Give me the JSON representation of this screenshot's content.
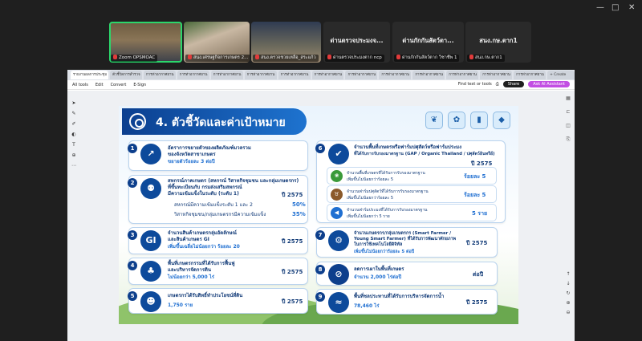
{
  "window": {
    "minimize": "—",
    "maximize": "□",
    "close": "✕"
  },
  "meeting": {
    "tiles": [
      {
        "name": "Zoom OPSMOAC",
        "label": "Zoom OPSMOAC"
      },
      {
        "name": "สนง.เศรษฐกิจการเกษตร",
        "label": "สนง.เศรษฐกิจการเกษตร 2..."
      },
      {
        "name": "สนง.ตรวจชวยเหลือ",
        "label": "สนง.ตรวจชวยเหลือ_สระแก้ว"
      },
      {
        "name": "ด่านตรวจประมงจ...",
        "label": "ด่านตรวจประมงตาก ncp"
      },
      {
        "name": "ด่านกักกันสัตว์ตา...",
        "label": "ด่านกักกันสัตว์ตาก วิชาชีพ 1"
      },
      {
        "name": "สนง.กษ.ตาก1",
        "label": "สนง.กษ.ตาก1"
      }
    ]
  },
  "browser": {
    "tabs": [
      "รายงานผลการประชุม",
      "ตัวชี้วัดการสำรวจ",
      "การท่าอากาศยาน",
      "การท่าอากาศยาน",
      "การท่าอากาศยาน",
      "การท่าอากาศยาน",
      "การท่าอากาศยาน",
      "การท่าอากาศยาน",
      "การท่าอากาศยาน",
      "การท่าอากาศยาน",
      "การท่าอากาศยาน",
      "การท่าอากาศยาน",
      "การท่าอากาศยาน",
      "การท่าอากาศยาน",
      "+ Create"
    ],
    "toolbar": [
      "All tools",
      "Edit",
      "Convert",
      "E-Sign"
    ],
    "find_label": "Find text or tools",
    "share": "Share",
    "ai": "Ask AI Assistant"
  },
  "slide": {
    "title": "4. ตัวชี้วัดและค่าเป้าหมาย",
    "top_icons": [
      "plant-hand",
      "sprout",
      "chart",
      "water-drop"
    ],
    "cards": [
      {
        "n": "1",
        "icon": "↗",
        "l1": "อัตราการขยายตัวของผลิตภัณฑ์มวลรวม",
        "l2": "ของจังหวัดสาขาเกษตร",
        "target": "ขยายตัวร้อยละ 3 ต่อปี"
      },
      {
        "n": "2",
        "icon": "👥",
        "l1": "สหกรณ์ภาคเกษตร (สหกรณ์ วิสาหกิจชุมชน และกลุ่มเกษตรกร)",
        "l2": "ที่ขึ้นทะเบียนกับ กรมส่งเสริมสหกรณ์",
        "l3": "มีความเข้มแข็งในระดับ (ระดับ 1)",
        "b1": "สหกรณ์มีความเข้มแข็งระดับ 1 และ 2",
        "b2": "วิสาหกิจชุมชน/กลุ่มเกษตรกรมีความเข้มแข็ง",
        "year": "ปี 2575",
        "v1": "50%",
        "v2": "35%"
      },
      {
        "n": "3",
        "icon": "GI",
        "l1": "จำนวนสินค้าเกษตรกลุ่มอัตลักษณ์",
        "l2": "และสินค้าเกษตร GI",
        "target": "เพิ่มขึ้นเฉลี่ยไม่น้อยกว่า ร้อยละ 20",
        "year": "ปี 2575"
      },
      {
        "n": "4",
        "icon": "🌱",
        "l1": "พื้นที่เกษตรกรรมที่ได้รับการฟื้นฟู",
        "l2": "และบริหารจัดการดิน",
        "target": "ไม่น้อยกว่า 5,000 ไร่",
        "year": "ปี 2575"
      },
      {
        "n": "5",
        "icon": "👨‍🌾",
        "l1": "เกษตรกรได้รับสิทธิ์ทำประโยชน์ที่ดิน",
        "target": "1,750 ราย",
        "year": "ปี 2575"
      },
      {
        "n": "6",
        "icon": "✔",
        "l1": "จำนวนพื้นที่เกษตรหรือฟาร์มปศุสัตว์หรือฟาร์มประมง",
        "l2": "ที่ได้รับการรับรองมาตรฐาน (GAP / Organic Thailand / ปศุสัตว์อินทรีย์)",
        "year": "ปี 2575",
        "subs": [
          {
            "icon": "🌾",
            "l1": "จำนวนพื้นที่เกษตรที่ได้รับการรับรองมาตรฐาน",
            "l2": "เพิ่มขึ้นไม่น้อยกว่าร้อยละ 5",
            "val": "ร้อยละ 5"
          },
          {
            "icon": "🐄",
            "l1": "จำนวนฟาร์มปศุสัตว์ที่ได้รับการรับรองมาตรฐาน",
            "l2": "เพิ่มขึ้นไม่น้อยกว่าร้อยละ 5",
            "val": "ร้อยละ 5"
          },
          {
            "icon": "🐟",
            "l1": "จำนวนฟาร์มประมงที่ได้รับการรับรองมาตรฐาน",
            "l2": "เพิ่มขึ้นไม่น้อยกว่า 5 ราย",
            "val": "5 ราย"
          }
        ]
      },
      {
        "n": "7",
        "icon": "📶",
        "l1": "จำนวนเกษตรกร/กลุ่มเกษตรกร (Smart Farmer /",
        "l2": "Young Smart Farmer) ที่ได้รับการพัฒนาศักยภาพ",
        "l3": "ในการใช้เทคโนโลยีดิจิทัล",
        "target": "เพิ่มขึ้นไม่น้อยกว่าร้อยละ 5 ต่อปี",
        "year": "ปี 2575"
      },
      {
        "n": "8",
        "icon": "🔥",
        "l1": "ลดการเผาในพื้นที่เกษตร",
        "target": "จำนวน 2,000 ไร่ต่อปี",
        "year": "ต่อปี"
      },
      {
        "n": "9",
        "icon": "💧",
        "l1": "พื้นที่ชลประทานที่ได้รับการบริหารจัดการน้ำ",
        "target": "78,460 ไร่",
        "year": "ปี 2575"
      }
    ]
  }
}
